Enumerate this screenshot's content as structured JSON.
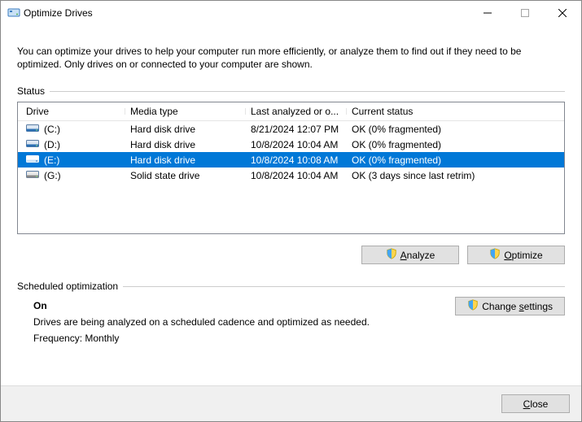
{
  "window": {
    "title": "Optimize Drives"
  },
  "intro": "You can optimize your drives to help your computer run more efficiently, or analyze them to find out if they need to be optimized. Only drives on or connected to your computer are shown.",
  "status_label": "Status",
  "columns": {
    "drive": "Drive",
    "media": "Media type",
    "last": "Last analyzed or o...",
    "status": "Current status"
  },
  "drives": [
    {
      "name": "(C:)",
      "media": "Hard disk drive",
      "last": "8/21/2024 12:07 PM",
      "status": "OK (0% fragmented)",
      "selected": false,
      "type": "hdd"
    },
    {
      "name": "(D:)",
      "media": "Hard disk drive",
      "last": "10/8/2024 10:04 AM",
      "status": "OK (0% fragmented)",
      "selected": false,
      "type": "hdd"
    },
    {
      "name": "(E:)",
      "media": "Hard disk drive",
      "last": "10/8/2024 10:08 AM",
      "status": "OK (0% fragmented)",
      "selected": true,
      "type": "hdd"
    },
    {
      "name": "(G:)",
      "media": "Solid state drive",
      "last": "10/8/2024 10:04 AM",
      "status": "OK (3 days since last retrim)",
      "selected": false,
      "type": "ssd"
    }
  ],
  "buttons": {
    "analyze": "Analyze",
    "optimize": "Optimize",
    "change_settings": "Change settings",
    "close": "Close"
  },
  "schedule": {
    "label": "Scheduled optimization",
    "on": "On",
    "desc": "Drives are being analyzed on a scheduled cadence and optimized as needed.",
    "freq": "Frequency: Monthly"
  }
}
